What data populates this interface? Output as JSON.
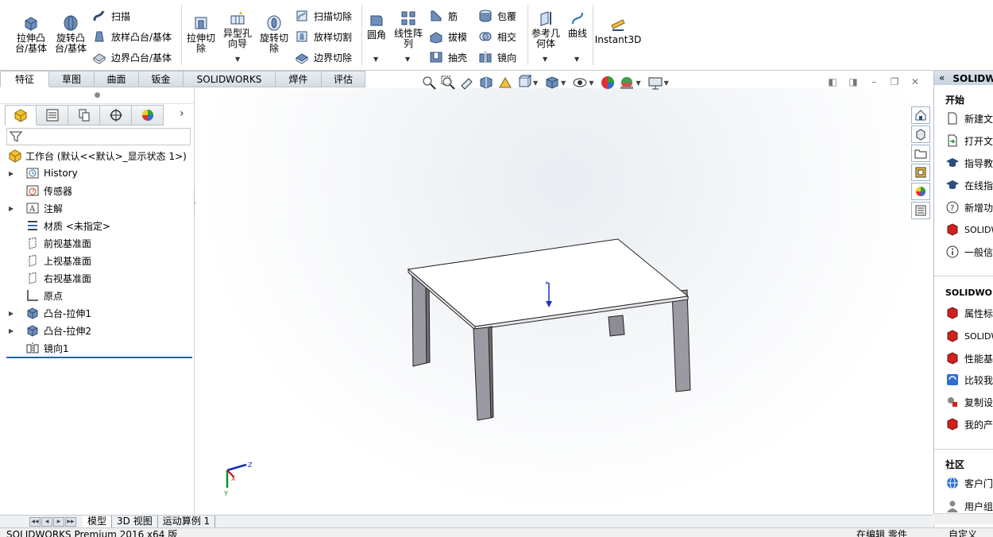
{
  "ribbon": {
    "extrude_boss": "拉伸凸\n台/基体",
    "revolve_boss": "旋转凸\n台/基体",
    "sweep": "扫描",
    "loft_boss": "放样凸台/基体",
    "boundary_boss": "边界凸台/基体",
    "extrude_cut": "拉伸切\n除",
    "hole_wizard": "异型孔\n向导",
    "revolve_cut": "旋转切\n除",
    "swept_cut": "扫描切除",
    "lofted_cut": "放样切割",
    "boundary_cut": "边界切除",
    "fillet": "圆角",
    "linear_pattern": "线性阵\n列",
    "rib": "筋",
    "draft": "拔模",
    "shell": "抽壳",
    "wrap": "包覆",
    "intersect": "相交",
    "mirror": "镜向",
    "reference_geometry": "参考几\n何体",
    "curves": "曲线",
    "instant3d": "Instant3D"
  },
  "command_tabs": [
    "特征",
    "草图",
    "曲面",
    "钣金",
    "SOLIDWORKS MBD",
    "焊件(D)",
    "评估"
  ],
  "feature_manager": {
    "root": "工作台  (默认<<默认>_显示状态 1>)",
    "items": [
      {
        "label": "History",
        "icon": "history-icon",
        "expandable": true
      },
      {
        "label": "传感器",
        "icon": "sensor-icon",
        "expandable": false
      },
      {
        "label": "注解",
        "icon": "annotation-icon",
        "expandable": true
      },
      {
        "label": "材质 <未指定>",
        "icon": "material-icon",
        "expandable": false
      },
      {
        "label": "前视基准面",
        "icon": "plane-icon",
        "expandable": false
      },
      {
        "label": "上视基准面",
        "icon": "plane-icon",
        "expandable": false
      },
      {
        "label": "右视基准面",
        "icon": "plane-icon",
        "expandable": false
      },
      {
        "label": "原点",
        "icon": "origin-icon",
        "expandable": false
      },
      {
        "label": "凸台-拉伸1",
        "icon": "extrude-feature-icon",
        "expandable": true
      },
      {
        "label": "凸台-拉伸2",
        "icon": "extrude-feature-icon",
        "expandable": true
      },
      {
        "label": "镜向1",
        "icon": "mirror-feature-icon",
        "expandable": false
      }
    ]
  },
  "task_pane": {
    "header": "SOLIDWORKS 资源",
    "section_start": "开始",
    "start_items": [
      "新建文档",
      "打开文档",
      "指导教程",
      "在线指南",
      "新增功能",
      "SOLIDWORKS Forum",
      "一般信息"
    ],
    "section_tools": "SOLIDWORKS 工具",
    "tool_items": [
      "属性标签编制程序",
      "SOLIDWORKS Rx",
      "性能基准测试",
      "比较我的得分",
      "复制设定向导",
      "我的产品"
    ],
    "section_community": "社区",
    "community_items": [
      "客户门户",
      "用户组"
    ]
  },
  "bottom_tabs": [
    "模型",
    "3D 视图",
    "运动算例 1"
  ],
  "status": {
    "left": "SOLIDWORKS Premium 2016 x64 版",
    "mid": "在编辑 零件",
    "right": "自定义"
  },
  "triad": {
    "x": "X",
    "y": "Y",
    "z": "Z"
  },
  "colors": {
    "accent": "#1f5fbf",
    "table_top": "#ffffff",
    "table_leg": "#9a9aa2"
  }
}
